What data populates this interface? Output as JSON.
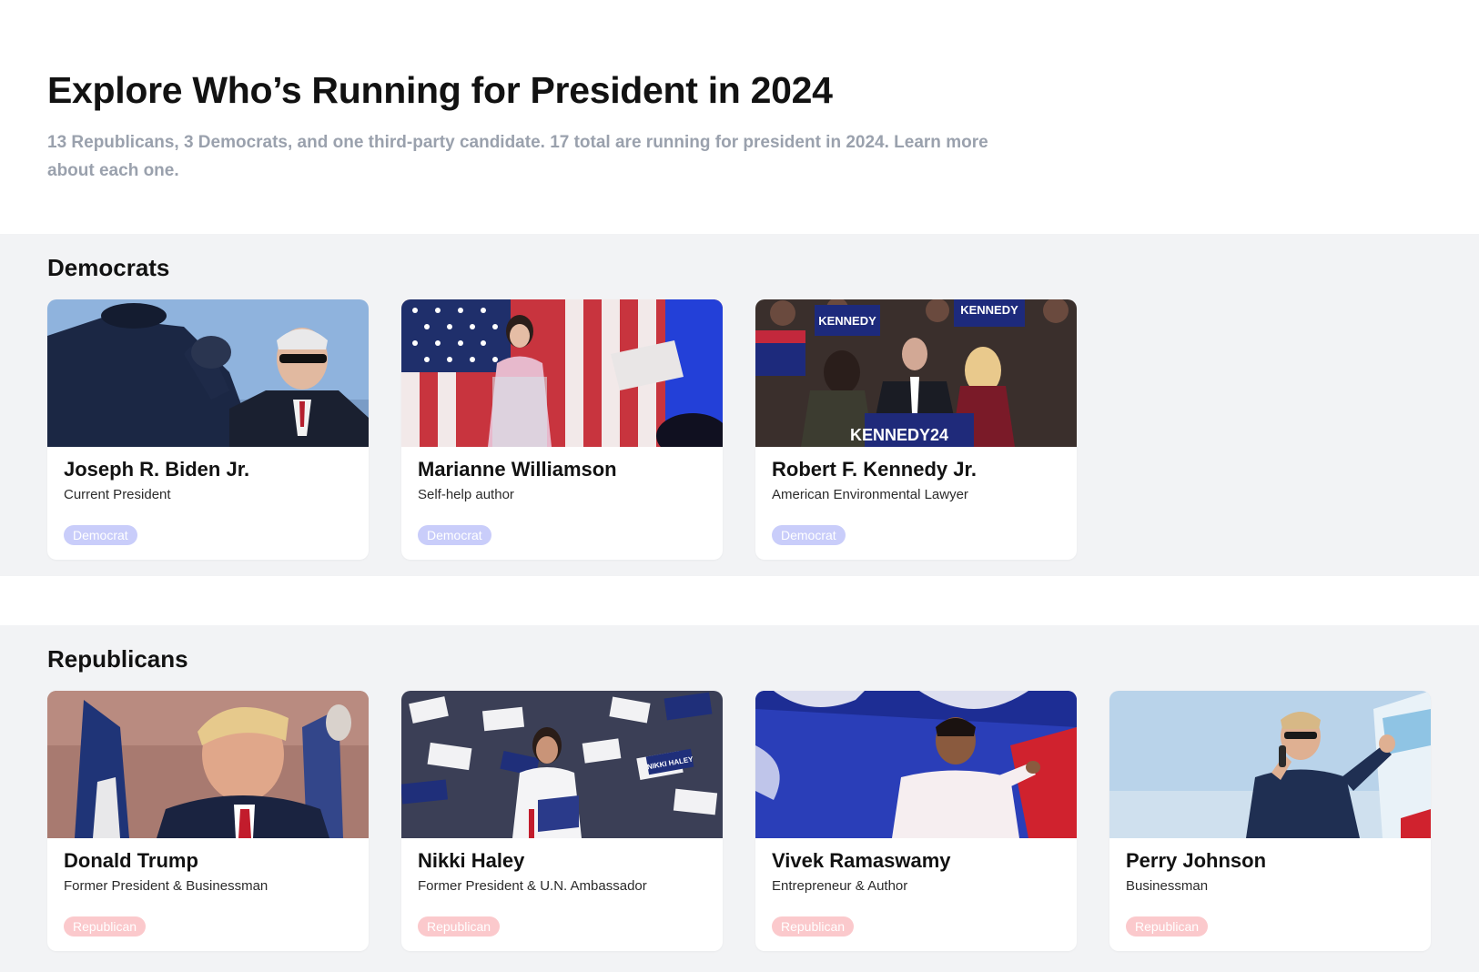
{
  "header": {
    "title": "Explore Who’s Running for President in 2024",
    "subtitle": "13 Republicans, 3 Democrats, and one third-party candidate. 17 total are running for president in 2024. Learn more about each one."
  },
  "sections": [
    {
      "title": "Democrats",
      "candidates": [
        {
          "name": "Joseph R. Biden Jr.",
          "role": "Current President",
          "party": "Democrat"
        },
        {
          "name": "Marianne Williamson",
          "role": "Self-help author",
          "party": "Democrat"
        },
        {
          "name": "Robert F. Kennedy Jr.",
          "role": "American Environmental Lawyer",
          "party": "Democrat"
        }
      ]
    },
    {
      "title": "Republicans",
      "candidates": [
        {
          "name": "Donald Trump",
          "role": "Former President & Businessman",
          "party": "Republican"
        },
        {
          "name": "Nikki Haley",
          "role": "Former President & U.N. Ambassador",
          "party": "Republican"
        },
        {
          "name": "Vivek Ramaswamy",
          "role": "Entrepreneur & Author",
          "party": "Republican"
        },
        {
          "name": "Perry Johnson",
          "role": "Businessman",
          "party": "Republican"
        }
      ]
    }
  ],
  "photo_signs": {
    "kennedy_1": "KENNEDY",
    "kennedy_2": "KENNEDY",
    "kennedy_3": "KENNEDY24",
    "haley": "NIKKI HALEY"
  },
  "colors": {
    "section_bg": "#f2f3f5",
    "democrat_badge": "#c9cdfa",
    "republican_badge": "#fbc9cc",
    "subtitle": "#9aa1ad"
  }
}
